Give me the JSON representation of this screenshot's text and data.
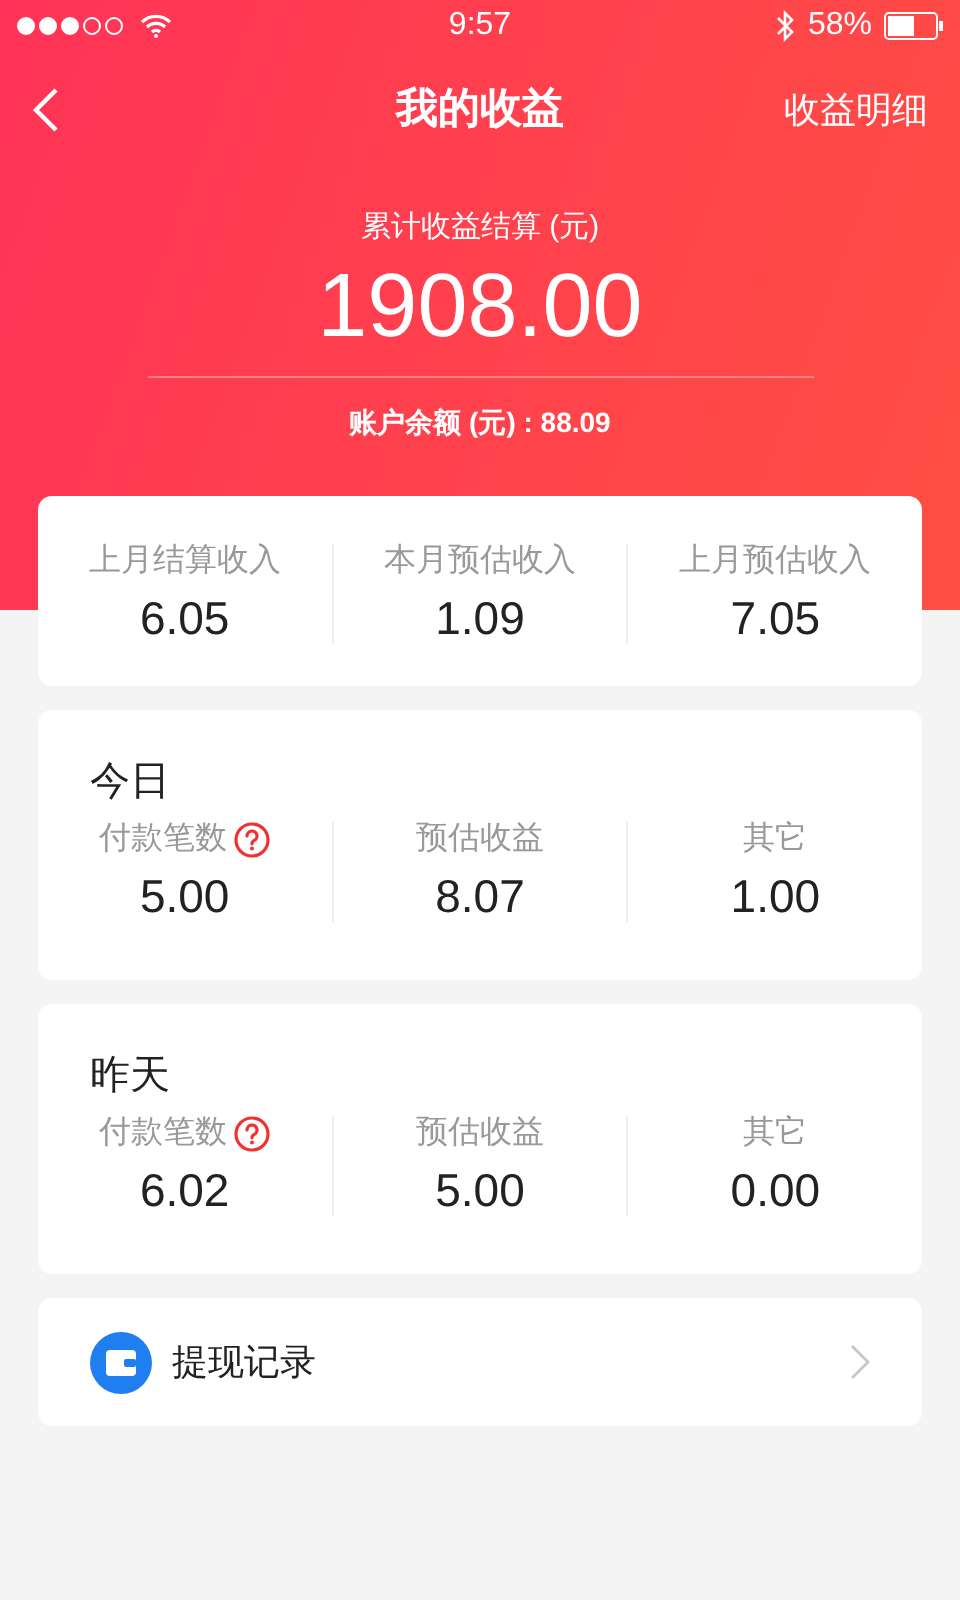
{
  "status_bar": {
    "time": "9:57",
    "battery": "58%"
  },
  "nav": {
    "title": "我的收益",
    "action": "收益明细"
  },
  "summary": {
    "label": "累计收益结算 (元)",
    "amount": "1908.00",
    "balance": "账户余额 (元) : 88.09"
  },
  "overview": [
    {
      "label": "上月结算收入",
      "value": "6.05"
    },
    {
      "label": "本月预估收入",
      "value": "1.09"
    },
    {
      "label": "上月预估收入",
      "value": "7.05"
    }
  ],
  "sections": [
    {
      "title": "今日",
      "stats": [
        {
          "label": "付款笔数",
          "value": "5.00",
          "help": true
        },
        {
          "label": "预估收益",
          "value": "8.07",
          "help": false
        },
        {
          "label": "其它",
          "value": "1.00",
          "help": false
        }
      ]
    },
    {
      "title": "昨天",
      "stats": [
        {
          "label": "付款笔数",
          "value": "6.02",
          "help": true
        },
        {
          "label": "预估收益",
          "value": "5.00",
          "help": false
        },
        {
          "label": "其它",
          "value": "0.00",
          "help": false
        }
      ]
    }
  ],
  "link": {
    "label": "提现记录"
  }
}
